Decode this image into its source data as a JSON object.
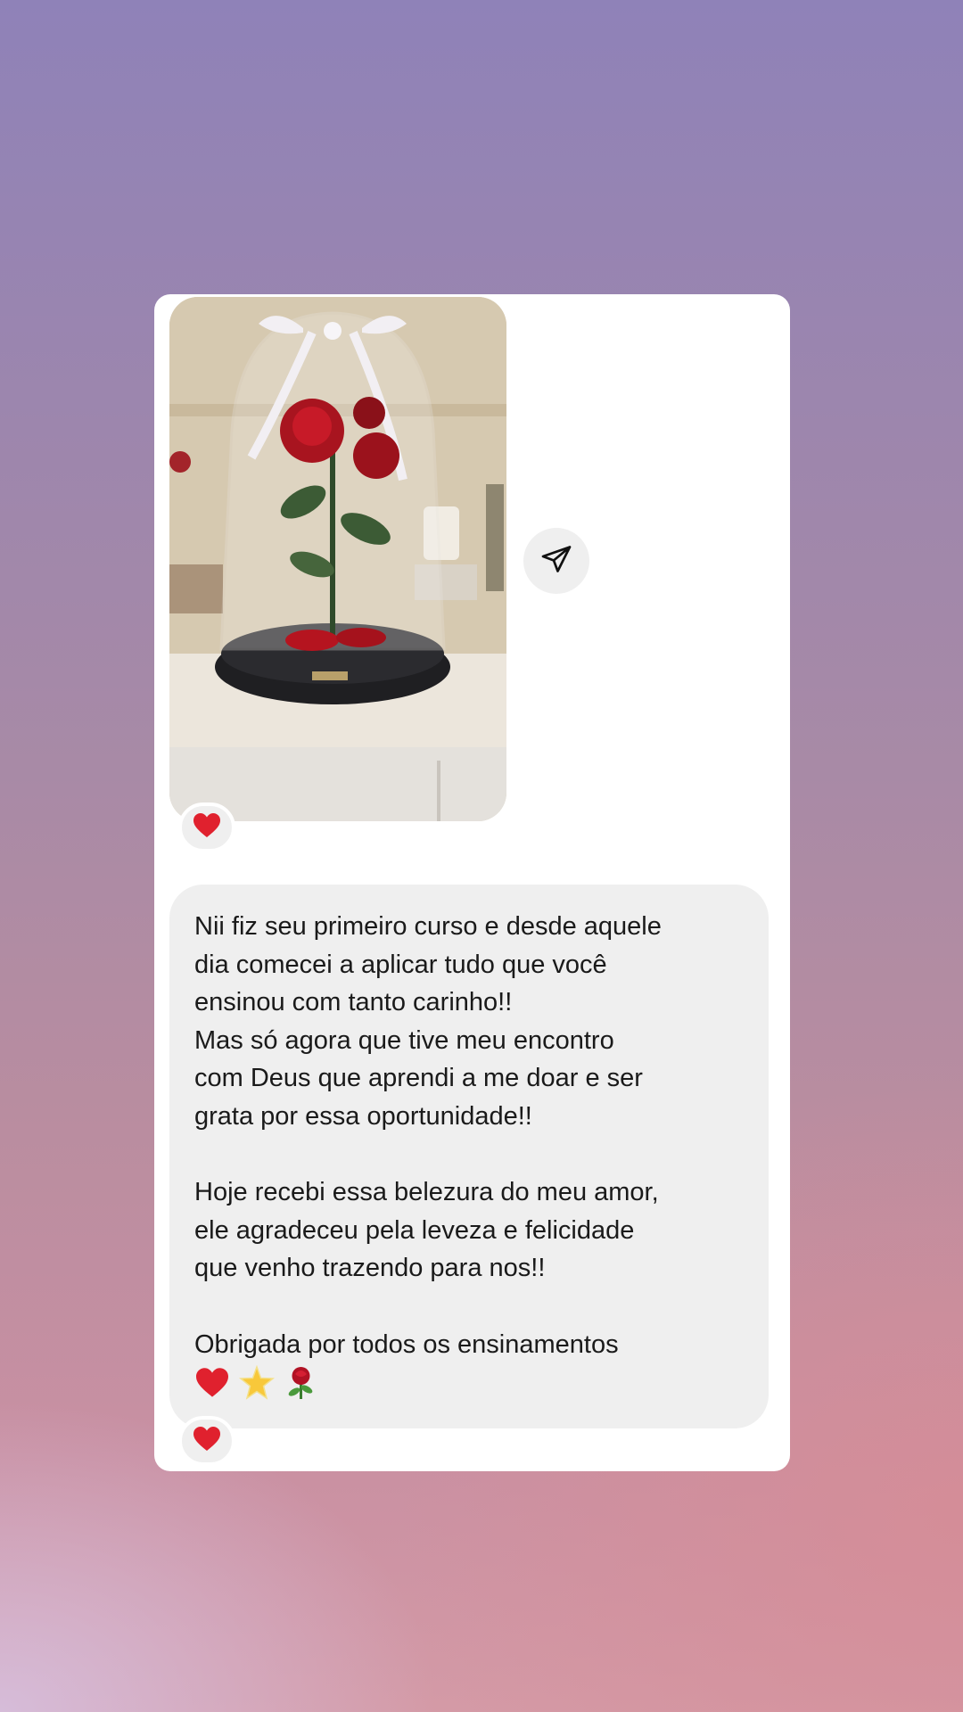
{
  "photo_message": {
    "image_description": "rose-in-glass-dome"
  },
  "share": {
    "icon": "paper-plane-icon"
  },
  "text_message": {
    "paragraphs": [
      [
        "Nii fiz seu primeiro curso e desde aquele",
        "dia comecei a aplicar tudo que você",
        "ensinou com tanto carinho!!",
        "Mas só agora que tive meu encontro",
        "com Deus que aprendi a me doar e ser",
        "grata por essa oportunidade!!"
      ],
      [
        "Hoje recebi essa belezura do meu amor,",
        "ele agradeceu pela leveza e felicidade",
        "que venho trazendo para nos!!"
      ],
      [
        "Obrigada por todos os ensinamentos"
      ]
    ],
    "emojis": [
      "red-heart-icon",
      "glowing-star-icon",
      "rose-icon"
    ]
  },
  "reactions": {
    "photo_reaction": "red-heart-icon",
    "text_reaction": "red-heart-icon"
  },
  "colors": {
    "bubble": "#efefef",
    "card": "#ffffff",
    "heart": "#e0212e"
  }
}
